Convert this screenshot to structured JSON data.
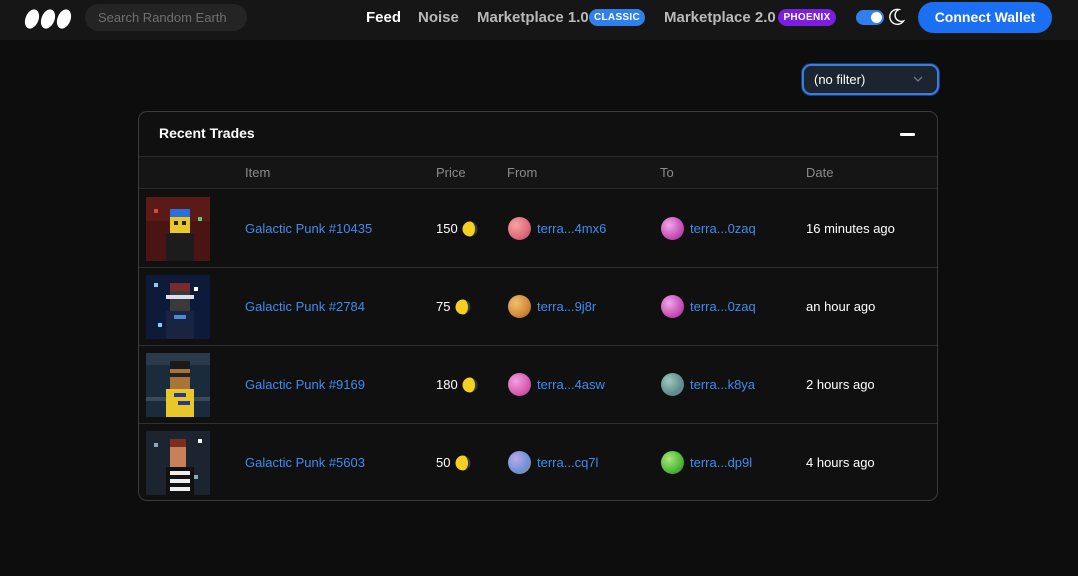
{
  "header": {
    "search_placeholder": "Search Random Earth",
    "nav": {
      "feed": "Feed",
      "noise": "Noise",
      "mp1": "Marketplace 1.0",
      "mp1_badge": "CLASSIC",
      "mp2": "Marketplace 2.0",
      "mp2_badge": "PHOENIX"
    },
    "theme_toggle_on": true,
    "connect_label": "Connect Wallet"
  },
  "filter": {
    "selected": "(no filter)"
  },
  "trades": {
    "title": "Recent Trades",
    "columns": {
      "item": "Item",
      "price": "Price",
      "from": "From",
      "to": "To",
      "date": "Date"
    },
    "rows": [
      {
        "item": "Galactic Punk #10435",
        "price": "150",
        "from": "terra...4mx6",
        "to": "terra...0zaq",
        "date": "16 minutes ago",
        "from_color": "#e06a7a",
        "to_color": "#c84fb8"
      },
      {
        "item": "Galactic Punk #2784",
        "price": "75",
        "from": "terra...9j8r",
        "to": "terra...0zaq",
        "date": "an hour ago",
        "from_color": "#d08a3a",
        "to_color": "#c84fb8"
      },
      {
        "item": "Galactic Punk #9169",
        "price": "180",
        "from": "terra...4asw",
        "to": "terra...k8ya",
        "date": "2 hours ago",
        "from_color": "#d85cb0",
        "to_color": "#5f8f8a"
      },
      {
        "item": "Galactic Punk #5603",
        "price": "50",
        "from": "terra...cq7l",
        "to": "terra...dp9l",
        "date": "4 hours ago",
        "from_color": "#6a93d8",
        "to_color": "#4fb83a"
      }
    ]
  },
  "colors": {
    "accent": "#1b6ff2",
    "link": "#3f8cf0",
    "classic_badge": "#2f80ed",
    "phoenix_badge": "#7a1fe0",
    "background": "#0d0d0d"
  },
  "icons": [
    "logo-icon",
    "moon-icon",
    "chevron-down-icon",
    "minus-icon",
    "luna-coin-icon"
  ]
}
